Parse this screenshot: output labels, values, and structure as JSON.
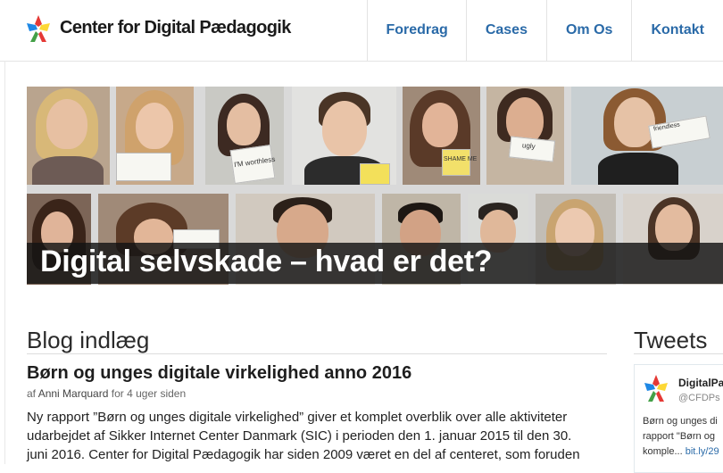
{
  "header": {
    "brand": "Center for Digital Pædagogik",
    "nav": [
      "Foredrag",
      "Cases",
      "Om Os",
      "Kontakt"
    ]
  },
  "hero": {
    "title": "Digital selvskade – hvad er det?",
    "sign_texts": [
      "I'M worthless",
      "SHAME ME",
      "ugly",
      "friendless"
    ]
  },
  "blog": {
    "heading": "Blog indlæg",
    "post": {
      "title": "Børn og unges digitale virkelighed anno 2016",
      "meta_prefix": "af",
      "author": "Anni Marquard",
      "meta_suffix": "for 4 uger siden",
      "body_lines": [
        "Ny rapport ”Børn og unges digitale virkelighed” giver et komplet overblik over alle aktiviteter",
        "udarbejdet af Sikker Internet Center Danmark (SIC) i perioden den 1. januar 2015 til den 30.",
        "juni 2016. Center for Digital Pædagogik har siden 2009 været en del af  centeret, som foruden"
      ]
    }
  },
  "tweets": {
    "heading": "Tweets",
    "name": "DigitalPa",
    "handle": "@CFDPs",
    "text_lines": [
      "Børn og unges di",
      "rapport \"Børn og",
      "komple..."
    ],
    "link": "bit.ly/29"
  },
  "colors": {
    "nav_link": "#2a6aa8",
    "logo": [
      "#e53935",
      "#43a047",
      "#1e88e5",
      "#fdd835"
    ]
  }
}
